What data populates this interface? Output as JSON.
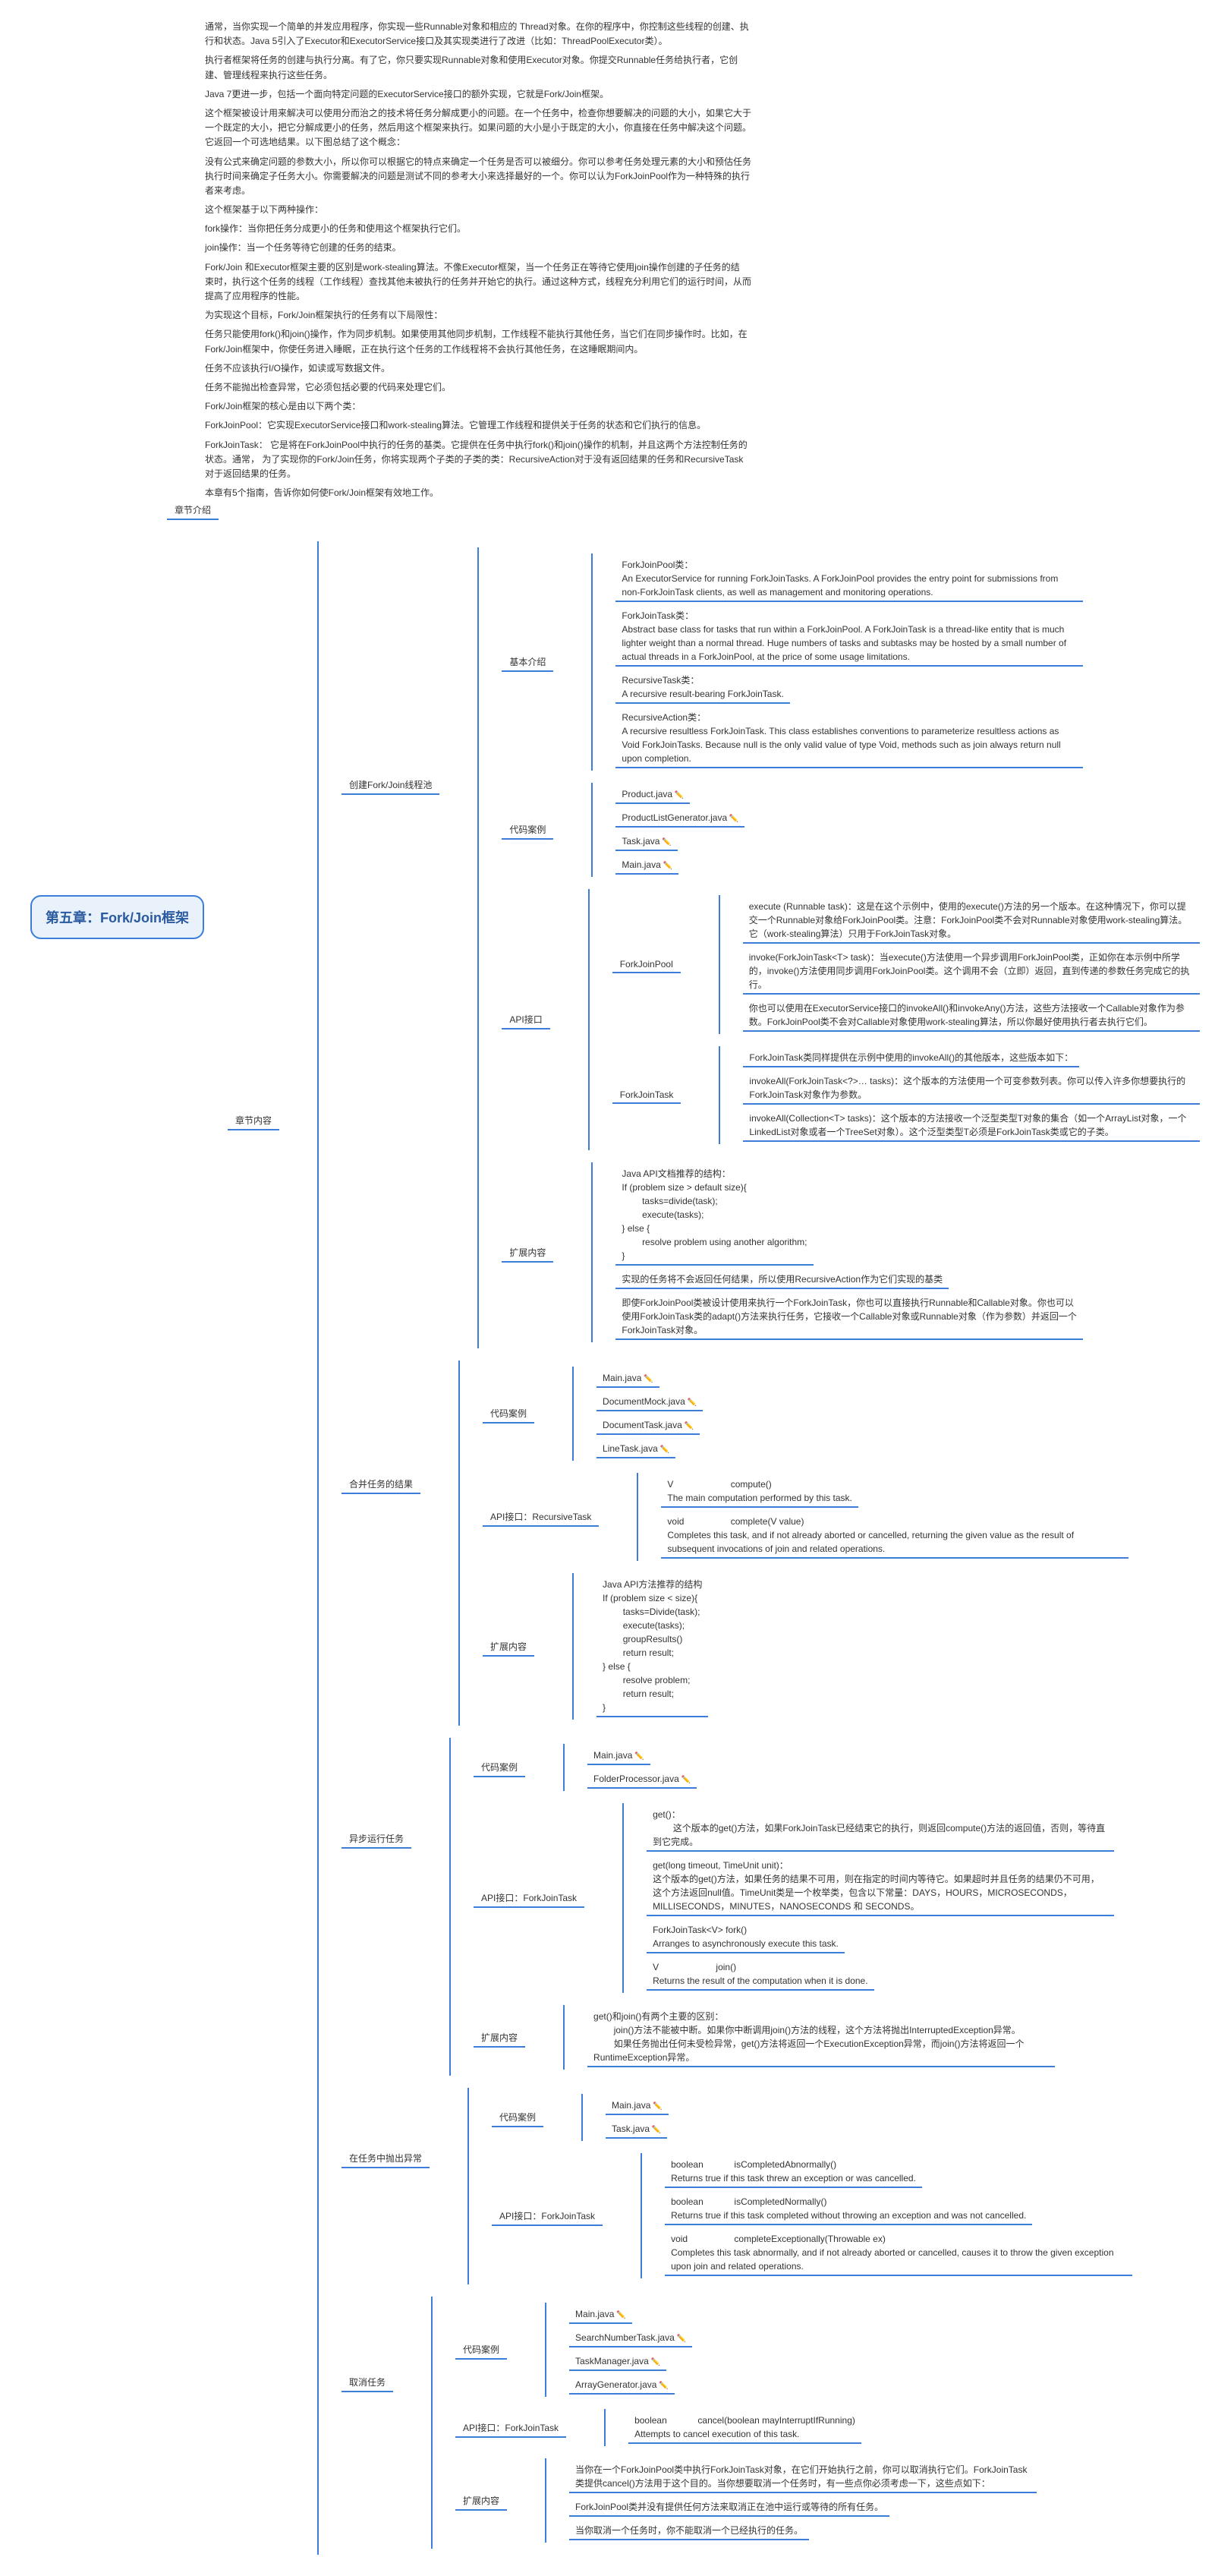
{
  "intro": {
    "p1": "通常，当你实现一个简单的并发应用程序，你实现一些Runnable对象和相应的 Thread对象。在你的程序中，你控制这些线程的创建、执行和状态。Java 5引入了Executor和ExecutorService接口及其实现类进行了改进（比如：ThreadPoolExecutor类）。",
    "p2": "执行者框架将任务的创建与执行分离。有了它，你只要实现Runnable对象和使用Executor对象。你提交Runnable任务给执行者，它创建、管理线程来执行这些任务。",
    "p3": "Java 7更进一步，包括一个面向特定问题的ExecutorService接口的额外实现，它就是Fork/Join框架。",
    "p4": "这个框架被设计用来解决可以使用分而治之的技术将任务分解成更小的问题。在一个任务中，检查你想要解决的问题的大小，如果它大于一个既定的大小，把它分解成更小的任务，然后用这个框架来执行。如果问题的大小是小于既定的大小，你直接在任务中解决这个问题。它返回一个可选地结果。以下图总结了这个概念：",
    "p5": "没有公式来确定问题的参数大小，所以你可以根据它的特点来确定一个任务是否可以被细分。你可以参考任务处理元素的大小和预估任务执行时间来确定子任务大小。你需要解决的问题是测试不同的参考大小来选择最好的一个。你可以认为ForkJoinPool作为一种特殊的执行者来考虑。",
    "p6": "这个框架基于以下两种操作：",
    "p7": "fork操作：当你把任务分成更小的任务和使用这个框架执行它们。",
    "p8": "join操作：当一个任务等待它创建的任务的结束。",
    "p9": "Fork/Join 和Executor框架主要的区别是work-stealing算法。不像Executor框架，当一个任务正在等待它使用join操作创建的子任务的结 束时，执行这个任务的线程（工作线程）查找其他未被执行的任务并开始它的执行。通过这种方式，线程充分利用它们的运行时间，从而提高了应用程序的性能。",
    "p10": "为实现这个目标，Fork/Join框架执行的任务有以下局限性：",
    "p11": "任务只能使用fork()和join()操作，作为同步机制。如果使用其他同步机制，工作线程不能执行其他任务，当它们在同步操作时。比如，在Fork/Join框架中，你使任务进入睡眠，正在执行这个任务的工作线程将不会执行其他任务，在这睡眠期间内。",
    "p12": "任务不应该执行I/O操作，如读或写数据文件。",
    "p13": "任务不能抛出检查异常，它必须包括必要的代码来处理它们。",
    "p14": "Fork/Join框架的核心是由以下两个类：",
    "p15": "ForkJoinPool：它实现ExecutorService接口和work-stealing算法。它管理工作线程和提供关于任务的状态和它们执行的信息。",
    "p16": "ForkJoinTask： 它是将在ForkJoinPool中执行的任务的基类。它提供在任务中执行fork()和join()操作的机制，并且这两个方法控制任务的状态。通常， 为了实现你的Fork/Join任务，你将实现两个子类的子类的类：RecursiveAction对于没有返回结果的任务和RecursiveTask 对于返回结果的任务。",
    "p17": "本章有5个指南，告诉你如何使Fork/Join框架有效地工作。"
  },
  "root": "第五章：Fork/Join框架",
  "L1": {
    "intro": "章节介绍",
    "content": "章节内容"
  },
  "create": {
    "title": "创建Fork/Join线程池",
    "basic": "基本介绍",
    "code": "代码案例",
    "api": "API接口",
    "ext": "扩展内容",
    "basic_items": {
      "fjp_title": "ForkJoinPool类：",
      "fjp_desc": "An ExecutorService for running ForkJoinTasks. A ForkJoinPool provides the entry point for submissions from non-ForkJoinTask clients, as well as management and monitoring operations.",
      "fjt_title": "ForkJoinTask类：",
      "fjt_desc": "Abstract base class for tasks that run within a ForkJoinPool. A ForkJoinTask is a thread-like entity that is much lighter weight than a normal thread. Huge numbers of tasks and subtasks may be hosted by a small number of actual threads in a ForkJoinPool, at the price of some usage limitations.",
      "rt_title": "RecursiveTask类：",
      "rt_desc": "A recursive result-bearing ForkJoinTask.",
      "ra_title": "RecursiveAction类：",
      "ra_desc": "A recursive resultless ForkJoinTask. This class establishes conventions to parameterize resultless actions as Void ForkJoinTasks. Because null is the only valid value of type Void, methods such as join always return null upon completion."
    },
    "files": {
      "f1": "Product.java",
      "f2": "ProductListGenerator.java",
      "f3": "Task.java",
      "f4": "Main.java"
    },
    "api_items": {
      "fjp": "ForkJoinPool",
      "fjt": "ForkJoinTask",
      "fjp_exec": "execute (Runnable task)：这是在这个示例中，使用的execute()方法的另一个版本。在这种情况下，你可以提交一个Runnable对象给ForkJoinPool类。注意：ForkJoinPool类不会对Runnable对象使用work-stealing算法。它（work-stealing算法）只用于ForkJoinTask对象。",
      "fjp_invoke": "invoke(ForkJoinTask<T> task)：当execute()方法使用一个异步调用ForkJoinPool类，正如你在本示例中所学的，invoke()方法使用同步调用ForkJoinPool类。这个调用不会（立即）返回，直到传递的参数任务完成它的执行。",
      "fjp_callable": "你也可以使用在ExecutorService接口的invokeAll()和invokeAny()方法，这些方法接收一个Callable对象作为参数。ForkJoinPool类不会对Callable对象使用work-stealing算法，所以你最好使用执行者去执行它们。",
      "fjt_intro": "ForkJoinTask类同样提供在示例中使用的invokeAll()的其他版本，这些版本如下：",
      "fjt_varargs": "invokeAll(ForkJoinTask<?>… tasks)：这个版本的方法使用一个可变参数列表。你可以传入许多你想要执行的ForkJoinTask对象作为参数。",
      "fjt_coll": "invokeAll(Collection<T> tasks)：这个版本的方法接收一个泛型类型T对象的集合（如一个ArrayList对象，一个LinkedList对象或者一个TreeSet对象）。这个泛型类型T必须是ForkJoinTask类或它的子类。"
    },
    "ext_items": {
      "e1": "Java API文档推荐的结构：\nIf (problem size > default size){\n        tasks=divide(task);\n        execute(tasks);\n} else {\n        resolve problem using another algorithm;\n}",
      "e2": "实现的任务将不会返回任何结果，所以使用RecursiveAction作为它们实现的基类",
      "e3": "即使ForkJoinPool类被设计使用来执行一个ForkJoinTask，你也可以直接执行Runnable和Callable对象。你也可以使用ForkJoinTask类的adapt()方法来执行任务，它接收一个Callable对象或Runnable对象（作为参数）并返回一个ForkJoinTask对象。"
    }
  },
  "merge": {
    "title": "合并任务的结果",
    "code": "代码案例",
    "api": "API接口：RecursiveTask",
    "ext": "扩展内容",
    "files": {
      "f1": "Main.java",
      "f2": "DocumentMock.java",
      "f3": "DocumentTask.java",
      "f4": "LineTask.java"
    },
    "api_items": {
      "compute_t": "V",
      "compute": "compute()\nThe main computation performed by this task.",
      "complete_t": "void",
      "complete": "complete(V value)\nCompletes this task, and if not already aborted or cancelled, returning the given value as the result of subsequent invocations of join and related operations."
    },
    "ext_text": "Java API方法推荐的结构\nIf (problem size < size){\n        tasks=Divide(task);\n        execute(tasks);\n        groupResults()\n        return result;\n} else {\n        resolve problem;\n        return result;\n}"
  },
  "async": {
    "title": "异步运行任务",
    "code": "代码案例",
    "api": "API接口：ForkJoinTask",
    "ext": "扩展内容",
    "files": {
      "f1": "Main.java",
      "f2": "FolderProcessor.java"
    },
    "api_items": {
      "get": "get()：\n        这个版本的get()方法，如果ForkJoinTask已经结束它的执行，则返回compute()方法的返回值，否则，等待直到它完成。",
      "get_to": "get(long timeout, TimeUnit unit)：\n这个版本的get()方法，如果任务的结果不可用，则在指定的时间内等待它。如果超时并且任务的结果仍不可用，这个方法返回null值。TimeUnit类是一个枚举类，包含以下常量：DAYS，HOURS，MICROSECONDS，MILLISECONDS，MINUTES，NANOSECONDS 和 SECONDS。",
      "fork_t": "ForkJoinTask<V>",
      "fork": "fork()\nArranges to asynchronously execute this task.",
      "join_t": "V",
      "join": "join()\nReturns the result of the computation when it is done."
    },
    "ext_text": "get()和join()有两个主要的区别：\n        join()方法不能被中断。如果你中断调用join()方法的线程，这个方法将抛出InterruptedException异常。\n        如果任务抛出任何未受检异常，get()方法将返回一个ExecutionException异常，而join()方法将返回一个RuntimeException异常。"
  },
  "exception": {
    "title": "在任务中抛出异常",
    "code": "代码案例",
    "api": "API接口：ForkJoinTask",
    "files": {
      "f1": "Main.java",
      "f2": "Task.java"
    },
    "api_items": {
      "abn_t": "boolean",
      "abn": "isCompletedAbnormally()\nReturns true if this task threw an exception or was cancelled.",
      "norm_t": "boolean",
      "norm": "isCompletedNormally()\nReturns true if this task completed without throwing an exception and was not cancelled.",
      "ce_t": "void",
      "ce": "completeExceptionally(Throwable ex)\nCompletes this task abnormally, and if not already aborted or cancelled, causes it to throw the given exception upon join and related operations."
    }
  },
  "cancel": {
    "title": "取消任务",
    "code": "代码案例",
    "api": "API接口：ForkJoinTask",
    "ext": "扩展内容",
    "files": {
      "f1": "Main.java",
      "f2": "SearchNumberTask.java",
      "f3": "TaskManager.java",
      "f4": "ArrayGenerator.java"
    },
    "api_items": {
      "cancel_t": "boolean",
      "cancel": "cancel(boolean mayInterruptIfRunning)\nAttempts to cancel execution of this task."
    },
    "ext_items": {
      "e1": "当你在一个ForkJoinPool类中执行ForkJoinTask对象，在它们开始执行之前，你可以取消执行它们。ForkJoinTask类提供cancel()方法用于这个目的。当你想要取消一个任务时，有一些点你必须考虑一下，这些点如下：",
      "e2": "ForkJoinPool类并没有提供任何方法来取消正在池中运行或等待的所有任务。",
      "e3": "当你取消一个任务时，你不能取消一个已经执行的任务。"
    }
  }
}
